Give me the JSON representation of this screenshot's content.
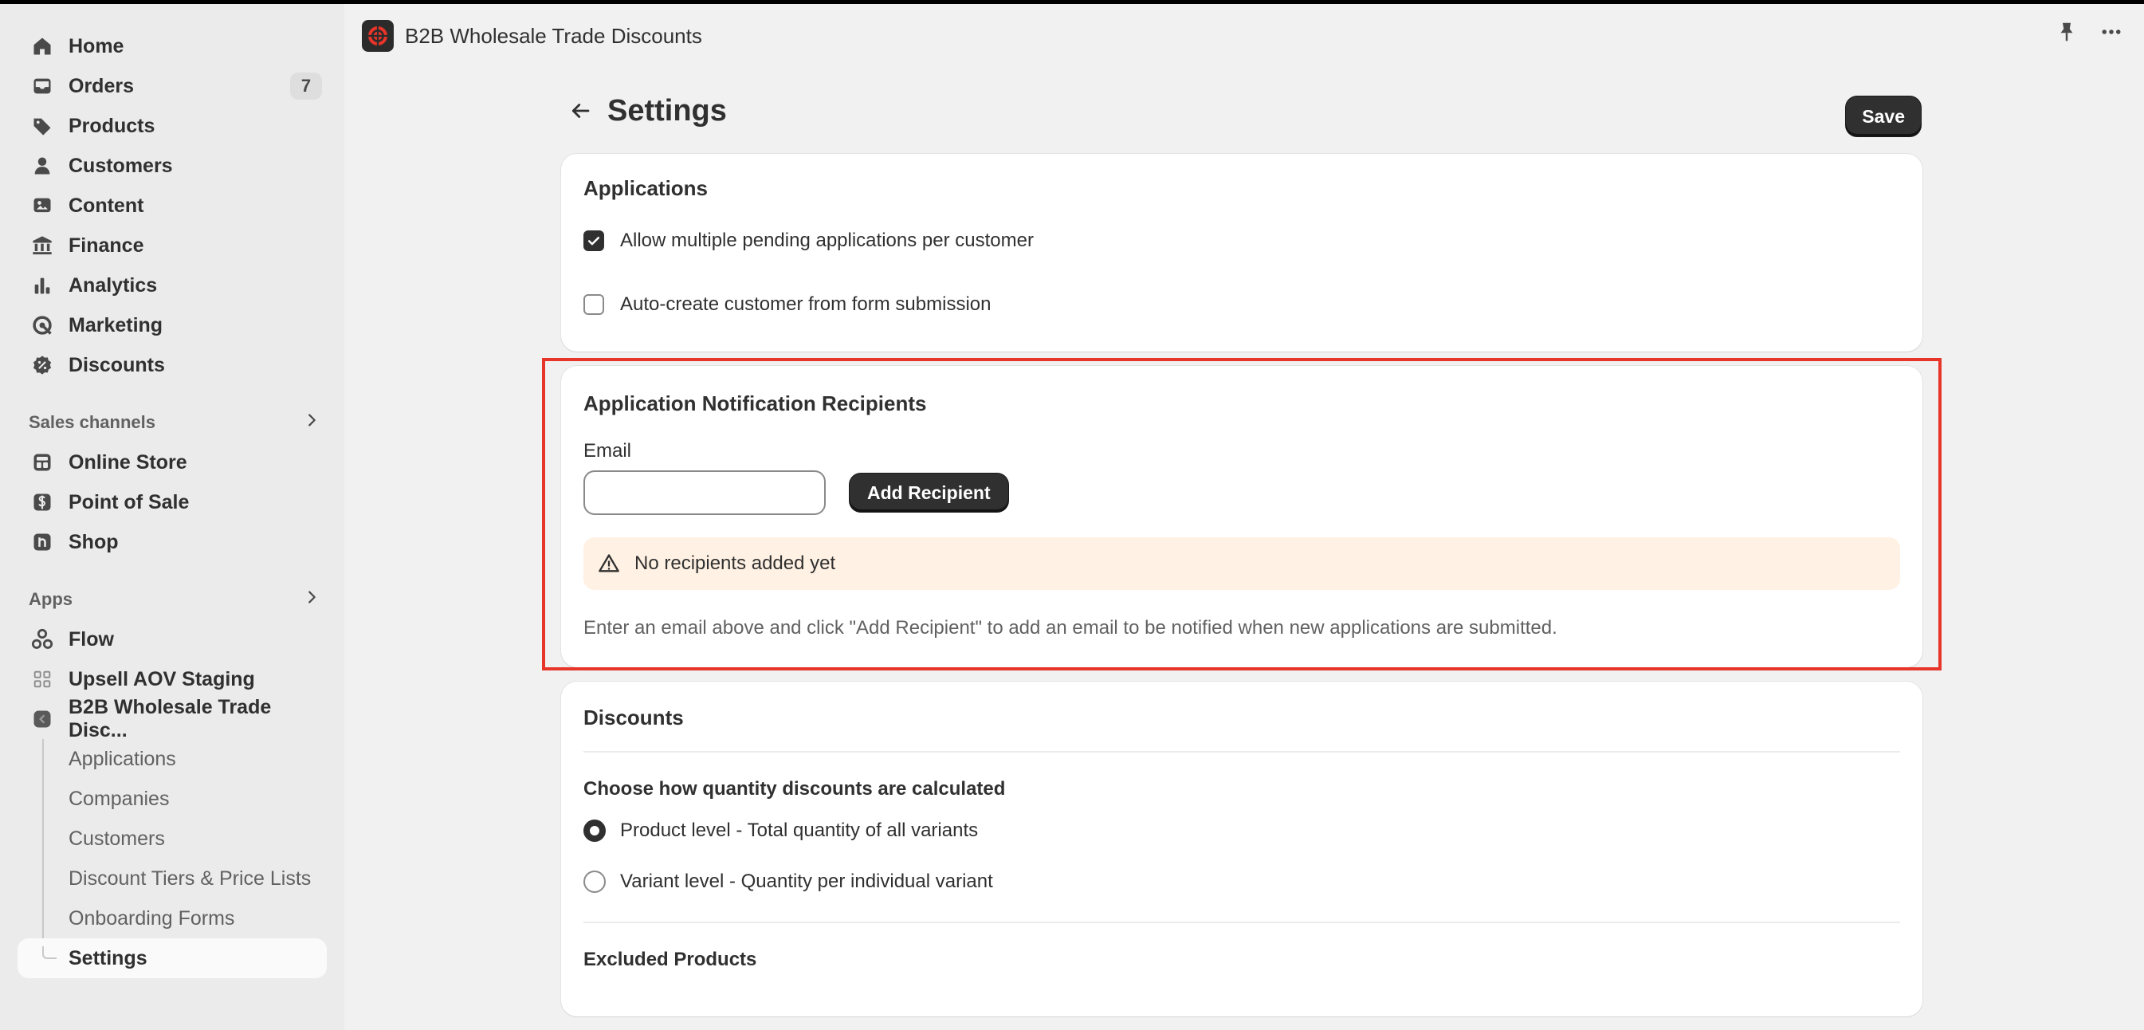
{
  "sidebar": {
    "items": [
      {
        "label": "Home",
        "icon": "home-icon"
      },
      {
        "label": "Orders",
        "icon": "inbox-icon",
        "badge": "7"
      },
      {
        "label": "Products",
        "icon": "tag-icon"
      },
      {
        "label": "Customers",
        "icon": "person-icon"
      },
      {
        "label": "Content",
        "icon": "image-icon"
      },
      {
        "label": "Finance",
        "icon": "bank-icon"
      },
      {
        "label": "Analytics",
        "icon": "bar-chart-icon"
      },
      {
        "label": "Marketing",
        "icon": "target-icon"
      },
      {
        "label": "Discounts",
        "icon": "discount-icon"
      }
    ],
    "sales_channels": {
      "header": "Sales channels",
      "items": [
        {
          "label": "Online Store",
          "icon": "store-icon"
        },
        {
          "label": "Point of Sale",
          "icon": "pos-icon"
        },
        {
          "label": "Shop",
          "icon": "shop-icon"
        }
      ]
    },
    "apps": {
      "header": "Apps",
      "items": [
        {
          "label": "Flow",
          "icon": "flow-icon"
        },
        {
          "label": "Upsell AOV Staging",
          "icon": "upsell-icon"
        },
        {
          "label": "B2B Wholesale Trade Disc...",
          "icon": "app-icon"
        }
      ],
      "subitems": [
        {
          "label": "Applications"
        },
        {
          "label": "Companies"
        },
        {
          "label": "Customers"
        },
        {
          "label": "Discount Tiers & Price Lists"
        },
        {
          "label": "Onboarding Forms"
        },
        {
          "label": "Settings",
          "active": true
        }
      ]
    }
  },
  "topbar": {
    "app_title": "B2B Wholesale Trade Discounts"
  },
  "page": {
    "title": "Settings",
    "save_label": "Save"
  },
  "applications": {
    "title": "Applications",
    "options": [
      {
        "label": "Allow multiple pending applications per customer",
        "checked": true
      },
      {
        "label": "Auto-create customer from form submission",
        "checked": false
      }
    ]
  },
  "recipients": {
    "title": "Application Notification Recipients",
    "email_label": "Email",
    "email_value": "",
    "add_label": "Add Recipient",
    "banner_text": "No recipients added yet",
    "help_text": "Enter an email above and click \"Add Recipient\" to add an email to be notified when new applications are submitted."
  },
  "discounts": {
    "title": "Discounts",
    "calc_title": "Choose how quantity discounts are calculated",
    "options": [
      {
        "label": "Product level - Total quantity of all variants",
        "selected": true
      },
      {
        "label": "Variant level - Quantity per individual variant",
        "selected": false
      }
    ],
    "excluded_title": "Excluded Products"
  },
  "colors": {
    "highlight": "#e8352a",
    "primary_button": "#303030",
    "banner_bg": "#fff1e3"
  }
}
